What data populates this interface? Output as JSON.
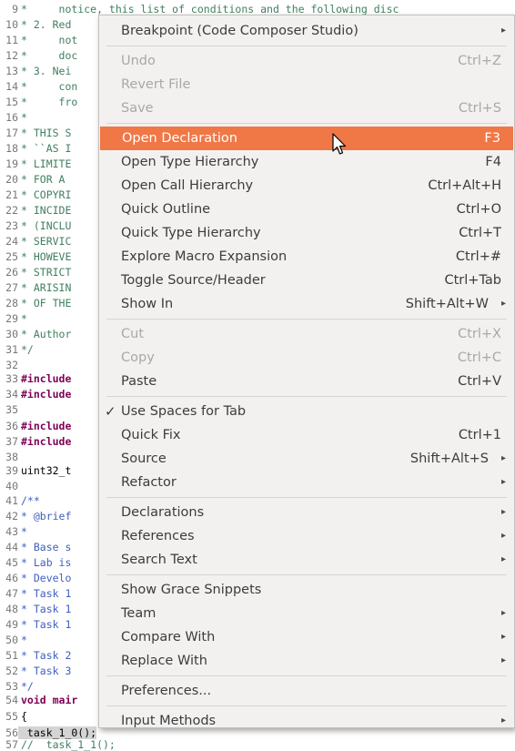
{
  "editor": {
    "lines": [
      {
        "n": "9",
        "t": "*     notice, this list of conditions and the following disc",
        "c": "ct"
      },
      {
        "n": "10",
        "t": "* 2. Red",
        "c": "ct"
      },
      {
        "n": "11",
        "t": "*     not",
        "c": "ct"
      },
      {
        "n": "12",
        "t": "*     doc",
        "c": "ct"
      },
      {
        "n": "13",
        "t": "* 3. Nei",
        "c": "ct"
      },
      {
        "n": "14",
        "t": "*     con",
        "c": "ct"
      },
      {
        "n": "15",
        "t": "*     fro",
        "c": "ct"
      },
      {
        "n": "16",
        "t": "*",
        "c": "ct"
      },
      {
        "n": "17",
        "t": "* THIS S",
        "c": "ct"
      },
      {
        "n": "18",
        "t": "* ``AS I",
        "c": "ct"
      },
      {
        "n": "19",
        "t": "* LIMITE",
        "c": "ct"
      },
      {
        "n": "20",
        "t": "* FOR A ",
        "c": "ct"
      },
      {
        "n": "21",
        "t": "* COPYRI",
        "c": "ct"
      },
      {
        "n": "22",
        "t": "* INCIDE",
        "c": "ct"
      },
      {
        "n": "23",
        "t": "* (INCLU",
        "c": "ct"
      },
      {
        "n": "24",
        "t": "* SERVIC",
        "c": "ct"
      },
      {
        "n": "25",
        "t": "* HOWEVE",
        "c": "ct"
      },
      {
        "n": "26",
        "t": "* STRICT",
        "c": "ct"
      },
      {
        "n": "27",
        "t": "* ARISIN",
        "c": "ct"
      },
      {
        "n": "28",
        "t": "* OF THE",
        "c": "ct"
      },
      {
        "n": "29",
        "t": "*",
        "c": "ct"
      },
      {
        "n": "30",
        "t": "* Author",
        "c": "ct"
      },
      {
        "n": "31",
        "t": "*/",
        "c": "ct"
      },
      {
        "n": "32",
        "t": "",
        "c": "ct"
      },
      {
        "n": "33",
        "t": "#include",
        "c": "ct kw"
      },
      {
        "n": "34",
        "t": "#include",
        "c": "ct kw"
      },
      {
        "n": "35",
        "t": "",
        "c": "ct"
      },
      {
        "n": "36",
        "t": "#include",
        "c": "ct kw"
      },
      {
        "n": "37",
        "t": "#include",
        "c": "ct kw"
      },
      {
        "n": "38",
        "t": "",
        "c": "ct"
      },
      {
        "n": "39",
        "t": "uint32_t",
        "c": "ct plain"
      },
      {
        "n": "40",
        "t": "",
        "c": "ct"
      },
      {
        "n": "41",
        "t": "/**",
        "c": "ct doc"
      },
      {
        "n": "42",
        "t": "* @brief",
        "c": "ct doc"
      },
      {
        "n": "43",
        "t": "*",
        "c": "ct doc"
      },
      {
        "n": "44",
        "t": "* Base s",
        "c": "ct doc"
      },
      {
        "n": "45",
        "t": "* Lab is",
        "c": "ct doc"
      },
      {
        "n": "46",
        "t": "* Develo",
        "c": "ct doc"
      },
      {
        "n": "47",
        "t": "* Task 1",
        "c": "ct doc"
      },
      {
        "n": "48",
        "t": "* Task 1",
        "c": "ct doc"
      },
      {
        "n": "49",
        "t": "* Task 1",
        "c": "ct doc"
      },
      {
        "n": "50",
        "t": "*",
        "c": "ct doc"
      },
      {
        "n": "51",
        "t": "* Task 2",
        "c": "ct doc"
      },
      {
        "n": "52",
        "t": "* Task 3",
        "c": "ct doc"
      },
      {
        "n": "53",
        "t": "*/",
        "c": "ct doc"
      },
      {
        "n": "54",
        "t": "void mair",
        "c": "ct kw"
      },
      {
        "n": "55",
        "t": "{",
        "c": "ct plain"
      },
      {
        "n": "56",
        "t": " task_1_0();",
        "c": "ct hl"
      },
      {
        "n": "57",
        "t": "//  task_1_1();",
        "c": "ct"
      }
    ]
  },
  "menu": {
    "items": [
      {
        "id": "breakpoint",
        "label": "Breakpoint (Code Composer Studio)",
        "shortcut": "",
        "sub": true
      },
      {
        "sep": true
      },
      {
        "id": "undo",
        "label": "Undo",
        "shortcut": "Ctrl+Z",
        "disabled": true
      },
      {
        "id": "revert-file",
        "label": "Revert File",
        "shortcut": "",
        "disabled": true
      },
      {
        "id": "save",
        "label": "Save",
        "shortcut": "Ctrl+S",
        "disabled": true
      },
      {
        "sep": true
      },
      {
        "id": "open-declaration",
        "label": "Open Declaration",
        "shortcut": "F3",
        "selected": true
      },
      {
        "id": "open-type-hierarchy",
        "label": "Open Type Hierarchy",
        "shortcut": "F4"
      },
      {
        "id": "open-call-hierarchy",
        "label": "Open Call Hierarchy",
        "shortcut": "Ctrl+Alt+H"
      },
      {
        "id": "quick-outline",
        "label": "Quick Outline",
        "shortcut": "Ctrl+O"
      },
      {
        "id": "quick-type-hierarchy",
        "label": "Quick Type Hierarchy",
        "shortcut": "Ctrl+T"
      },
      {
        "id": "explore-macro-expansion",
        "label": "Explore Macro Expansion",
        "shortcut": "Ctrl+#"
      },
      {
        "id": "toggle-source-header",
        "label": "Toggle Source/Header",
        "shortcut": "Ctrl+Tab"
      },
      {
        "id": "show-in",
        "label": "Show In",
        "shortcut": "Shift+Alt+W",
        "sub": true
      },
      {
        "sep": true
      },
      {
        "id": "cut",
        "label": "Cut",
        "shortcut": "Ctrl+X",
        "disabled": true
      },
      {
        "id": "copy",
        "label": "Copy",
        "shortcut": "Ctrl+C",
        "disabled": true
      },
      {
        "id": "paste",
        "label": "Paste",
        "shortcut": "Ctrl+V"
      },
      {
        "sep": true
      },
      {
        "id": "use-spaces-for-tab",
        "label": "Use Spaces for Tab",
        "shortcut": "",
        "checked": true
      },
      {
        "id": "quick-fix",
        "label": "Quick Fix",
        "shortcut": "Ctrl+1"
      },
      {
        "id": "source",
        "label": "Source",
        "shortcut": "Shift+Alt+S",
        "sub": true
      },
      {
        "id": "refactor",
        "label": "Refactor",
        "shortcut": "",
        "sub": true
      },
      {
        "sep": true
      },
      {
        "id": "declarations",
        "label": "Declarations",
        "shortcut": "",
        "sub": true
      },
      {
        "id": "references",
        "label": "References",
        "shortcut": "",
        "sub": true
      },
      {
        "id": "search-text",
        "label": "Search Text",
        "shortcut": "",
        "sub": true
      },
      {
        "sep": true
      },
      {
        "id": "show-grace-snippets",
        "label": "Show Grace Snippets",
        "shortcut": ""
      },
      {
        "id": "team",
        "label": "Team",
        "shortcut": "",
        "sub": true
      },
      {
        "id": "compare-with",
        "label": "Compare With",
        "shortcut": "",
        "sub": true
      },
      {
        "id": "replace-with",
        "label": "Replace With",
        "shortcut": "",
        "sub": true
      },
      {
        "sep": true
      },
      {
        "id": "preferences",
        "label": "Preferences...",
        "shortcut": ""
      },
      {
        "sep": true
      },
      {
        "id": "input-methods",
        "label": "Input Methods",
        "shortcut": "",
        "sub": true
      }
    ],
    "check_glyph": "✓",
    "submenu_glyph": "▸",
    "selected_color": "#f07746",
    "cursor_icon": "arrow-pointer-icon"
  }
}
